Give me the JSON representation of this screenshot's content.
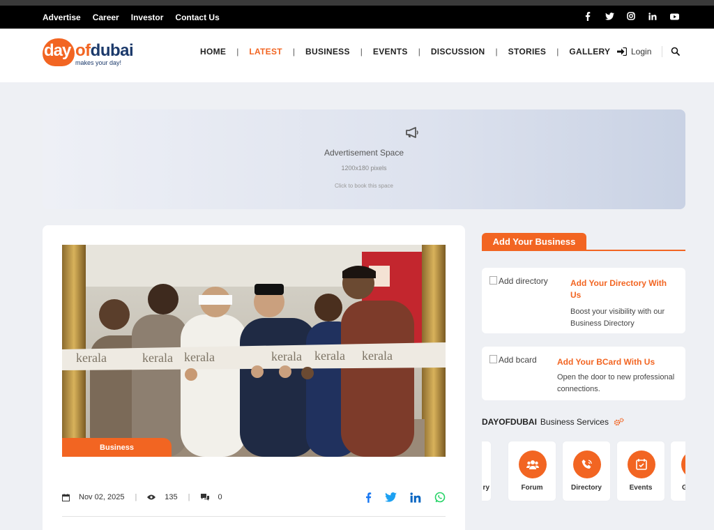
{
  "topbar": {
    "links": [
      "Advertise",
      "Career",
      "Investor",
      "Contact Us"
    ],
    "social": [
      "f",
      "t",
      "ig",
      "in",
      "yt"
    ]
  },
  "header": {
    "logo": {
      "brand_part1": "day",
      "brand_part2": "of",
      "brand_part3": "dubai",
      "tagline": "makes your day!"
    },
    "nav": [
      "HOME",
      "LATEST",
      "BUSINESS",
      "EVENTS",
      "DISCUSSION",
      "STORIES",
      "GALLERY"
    ],
    "active_nav": "LATEST",
    "login": "Login",
    "icons": {
      "login": "sign-in-icon",
      "search": "search-icon"
    }
  },
  "ad": {
    "title": "Advertisement Space",
    "size": "1200x180 pixels",
    "cta": "Click to book this space",
    "icon": "megaphone-icon"
  },
  "article": {
    "category": "Business",
    "date": "Nov 02, 2025",
    "views": "135",
    "comments": "0",
    "share_icons": [
      "facebook-icon",
      "twitter-icon",
      "linkedin-icon",
      "whatsapp-icon"
    ],
    "image_text": "kerala",
    "share_colors": {
      "facebook": "#1877f2",
      "twitter": "#1da1f2",
      "linkedin": "#0a66c2",
      "whatsapp": "#25d366"
    }
  },
  "sidebar": {
    "heading": "Add Your Business",
    "promos": [
      {
        "alt": "Add directory",
        "title": "Add Your Directory With Us",
        "desc": "Boost your visibility with our Business Directory"
      },
      {
        "alt": "Add bcard",
        "title": "Add Your BCard With Us",
        "desc": "Open the door to new professional connections."
      }
    ],
    "services_brand": "DAYOFDUBAI",
    "services_title": "Business Services",
    "services": [
      {
        "label": "ry",
        "icon": "book-icon"
      },
      {
        "label": "Forum",
        "icon": "users-icon"
      },
      {
        "label": "Directory",
        "icon": "phone-icon"
      },
      {
        "label": "Events",
        "icon": "calendar-icon"
      },
      {
        "label": "G",
        "icon": "gallery-icon"
      }
    ]
  },
  "colors": {
    "accent": "#f26522",
    "brand_navy": "#1c3a6b",
    "topbar": "#000000"
  }
}
